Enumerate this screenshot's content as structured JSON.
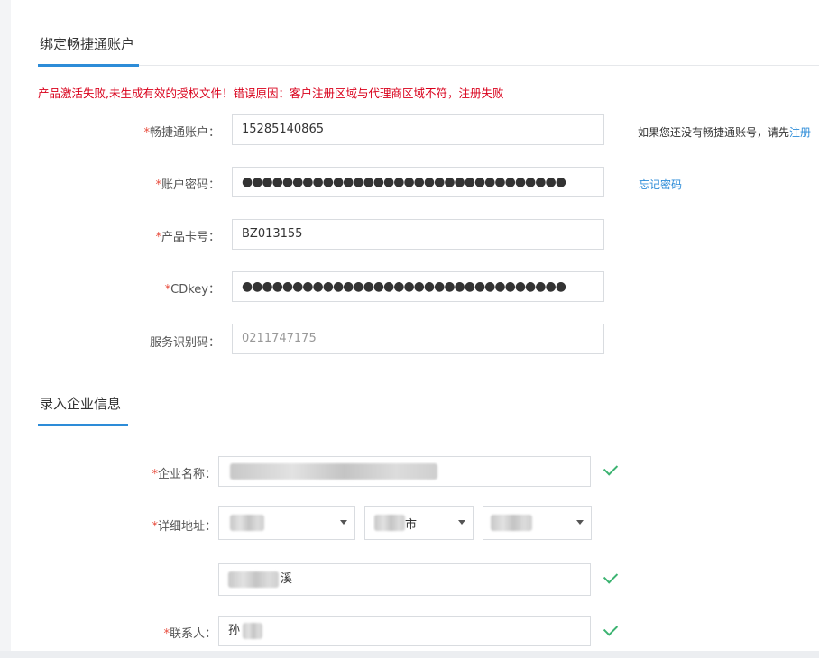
{
  "bind_account": {
    "title": "绑定畅捷通账户",
    "error": "产品激活失败,未生成有效的授权文件！错误原因：客户注册区域与代理商区域不符，注册失败",
    "required_mark": "*",
    "account_label": "畅捷通账户：",
    "account_value": "15285140865",
    "password_label": "账户密码：",
    "password_value": "●●●●●●●●●●●●●●●●●●●●●●●●●●●●●●●●",
    "card_label": "产品卡号：",
    "card_value": "BZ013155",
    "cdkey_label": "CDkey：",
    "cdkey_value": "●●●●●●●●●●●●●●●●●●●●●●●●●●●●●●●●",
    "service_label": "服务识别码：",
    "service_value": "0211747175",
    "no_account_hint": "如果您还没有畅捷通账号，请先",
    "register_link": "注册",
    "forgot_link": "忘记密码"
  },
  "company_info": {
    "title": "录入企业信息",
    "name_label": "企业名称：",
    "address_label": "详细地址：",
    "province_partial": "",
    "city_partial": "市",
    "street_partial": "溪",
    "contact_label": "联系人：",
    "contact_partial": "孙"
  },
  "colors": {
    "accent": "#2d8cd8",
    "error": "#d9001b",
    "required": "#e84c3d",
    "valid_check": "#3cb371"
  }
}
